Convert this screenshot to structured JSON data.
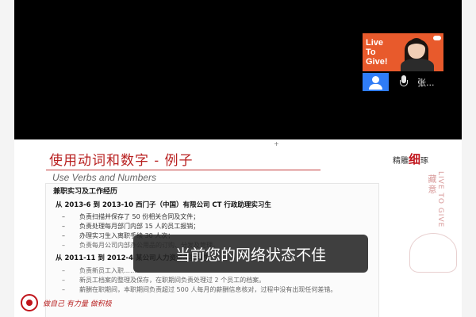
{
  "video": {
    "live_text": [
      "Live",
      "To",
      "Give!"
    ]
  },
  "participant": {
    "name": "张..."
  },
  "slide": {
    "marker": "+",
    "title": "使用动词和数字 - 例子",
    "subtitle": "Use Verbs and Numbers",
    "brand_prefix": "精雕",
    "brand_emphasis": "细",
    "brand_suffix": "琢",
    "deco_vertical": "藏意",
    "deco_live": "LIVE TO GIVE",
    "section_heading": "兼职实习及工作经历",
    "job1": "从 2013-6 到 2013-10 西门子（中国）有限公司 CT    行政助理实习生",
    "job1_bullets": [
      "负责扫描并保存了 50 份相关合同及文件；",
      "负责处理每月部门内部 15 人的员工报销；",
      "办理实习生入离职手续 30 人次；",
      "负责每月公司内部办公用品的订购、分发及管理。"
    ],
    "job2": "从 2011-11 到 2012-4 某公司人力资源部实习生",
    "job2_bullets": [
      "负责新员工入职……",
      "新员工档案的整理及保存，在职期间负责处理过 2 个员工的档案。",
      "薪酬在职期间，本职期间负责超过 500 人每月的薪酬信息核对，过程中没有出现任何差错。"
    ],
    "footer_slogan": "做自己 有力量 做积极"
  },
  "toast": {
    "message": "当前您的网络状态不佳"
  },
  "colors": {
    "accent_red": "#b81f1f",
    "video_orange": "#e85a2c",
    "avatar_blue": "#2f7cf6"
  }
}
